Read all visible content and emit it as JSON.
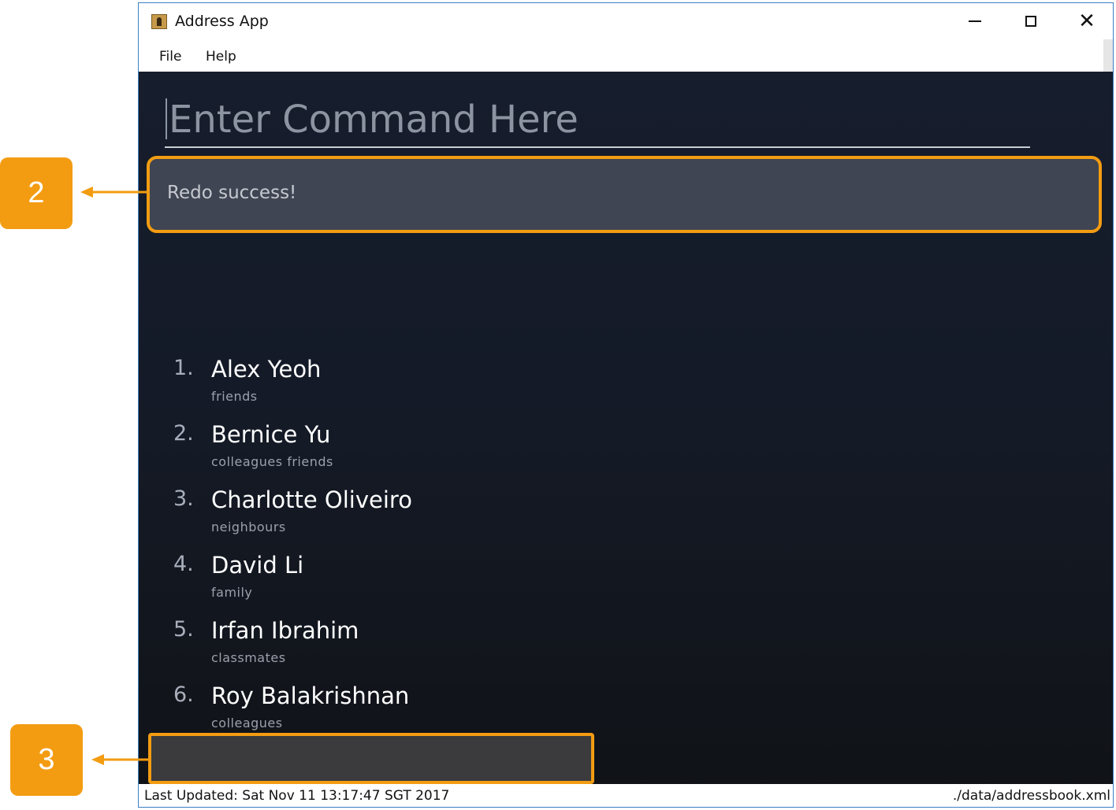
{
  "window": {
    "title": "Address App",
    "menu": [
      "File",
      "Help"
    ]
  },
  "command_box": {
    "placeholder": "Enter Command Here"
  },
  "result_display": {
    "text": "Redo success!"
  },
  "persons": [
    {
      "index": "1.",
      "name": "Alex Yeoh",
      "tags": "friends"
    },
    {
      "index": "2.",
      "name": "Bernice Yu",
      "tags": "colleagues  friends"
    },
    {
      "index": "3.",
      "name": "Charlotte Oliveiro",
      "tags": "neighbours"
    },
    {
      "index": "4.",
      "name": "David Li",
      "tags": "family"
    },
    {
      "index": "5.",
      "name": "Irfan Ibrahim",
      "tags": "classmates"
    },
    {
      "index": "6.",
      "name": "Roy Balakrishnan",
      "tags": "colleagues"
    }
  ],
  "status_bar": {
    "last_updated": "Last Updated: Sat Nov 11 13:17:47 SGT 2017",
    "file_path": "./data/addressbook.xml"
  },
  "callouts": {
    "result": "2",
    "status": "3"
  },
  "colors": {
    "accent": "#f39c12",
    "background": "#161d2c",
    "result_bg": "#3f4552"
  }
}
